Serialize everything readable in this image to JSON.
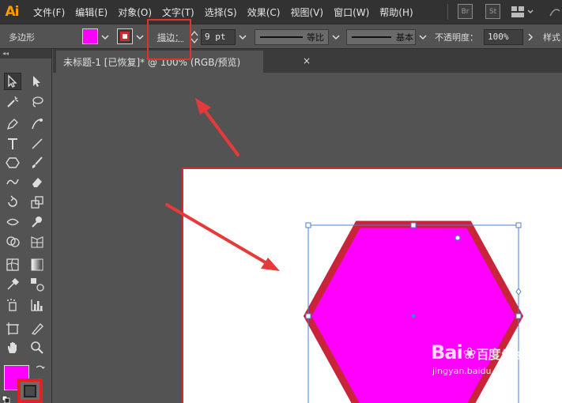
{
  "app": {
    "logo": "Ai",
    "accent": "#ff9a00"
  },
  "menu": [
    "文件(F)",
    "编辑(E)",
    "对象(O)",
    "文字(T)",
    "选择(S)",
    "效果(C)",
    "视图(V)",
    "窗口(W)",
    "帮助(H)"
  ],
  "menubar_right": {
    "badge_br": "Br",
    "badge_st": "St"
  },
  "controlbar": {
    "object_type": "多边形",
    "fill_color": "#ff00ff",
    "stroke_color": "#d12a2a",
    "stroke_label": "描边：",
    "stroke_weight": "9 pt",
    "profile_label": "等比",
    "brush_label": "基本",
    "opacity_label": "不透明度：",
    "opacity_value": "100%",
    "style_label": "样式"
  },
  "tabbar": {
    "document_tab": "未标题-1 [已恢复]* @ 100% (RGB/预览)",
    "close": "×"
  },
  "toolpanel": {
    "header": "◂◂"
  },
  "watermark": {
    "brand": "Bai",
    "brand_suffix": "百度",
    "sub": "经验",
    "site": "jingyan.baidu.com"
  },
  "canvas": {
    "shape_fill": "#ff00ff",
    "shape_stroke": "#c8253a",
    "selection_color": "#4a7fd6",
    "arrow_color": "#e53a3a"
  }
}
